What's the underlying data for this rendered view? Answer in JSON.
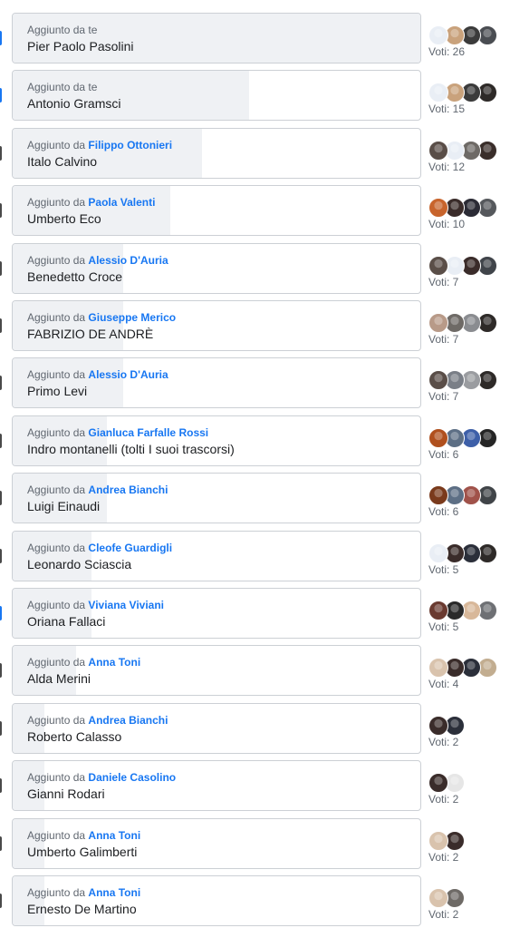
{
  "poll": {
    "options": [
      {
        "added_prefix": "Aggiunto da",
        "added_by": "te",
        "is_self": true,
        "name": "Pier Paolo Pasolini",
        "votes_label": "Voti: 26",
        "votes": 26,
        "checked": true,
        "voter_colors": [
          "#e9eef5",
          "#c9a27c",
          "#3b3b3b",
          "#4a4d52"
        ]
      },
      {
        "added_prefix": "Aggiunto da",
        "added_by": "te",
        "is_self": true,
        "name": "Antonio Gramsci",
        "votes_label": "Voti: 15",
        "votes": 15,
        "checked": true,
        "voter_colors": [
          "#e9eef5",
          "#c9a27c",
          "#3b3b3b",
          "#2e2a28"
        ]
      },
      {
        "added_prefix": "Aggiunto da",
        "added_by": "Filippo Ottonieri",
        "is_self": false,
        "name": "Italo Calvino",
        "votes_label": "Voti: 12",
        "votes": 12,
        "checked": false,
        "voter_colors": [
          "#5a4e48",
          "#e9eef5",
          "#6e6a66",
          "#3a2e2a"
        ]
      },
      {
        "added_prefix": "Aggiunto da",
        "added_by": "Paola Valenti",
        "is_self": false,
        "name": "Umberto Eco",
        "votes_label": "Voti: 10",
        "votes": 10,
        "checked": false,
        "voter_colors": [
          "#c8642c",
          "#3a2c2a",
          "#2b2b35",
          "#55585c"
        ]
      },
      {
        "added_prefix": "Aggiunto da",
        "added_by": "Alessio D'Auria",
        "is_self": false,
        "name": "Benedetto Croce",
        "votes_label": "Voti: 7",
        "votes": 7,
        "checked": false,
        "voter_colors": [
          "#5a4e48",
          "#e9eef5",
          "#3a2c2a",
          "#40444a"
        ]
      },
      {
        "added_prefix": "Aggiunto da",
        "added_by": "Giuseppe Merico",
        "is_self": false,
        "name": "FABRIZIO DE ANDRÈ",
        "votes_label": "Voti: 7",
        "votes": 7,
        "checked": false,
        "voter_colors": [
          "#b89a88",
          "#6e6a66",
          "#8a8c90",
          "#2e2a28"
        ]
      },
      {
        "added_prefix": "Aggiunto da",
        "added_by": "Alessio D'Auria",
        "is_self": false,
        "name": "Primo Levi",
        "votes_label": "Voti: 7",
        "votes": 7,
        "checked": false,
        "voter_colors": [
          "#5a4e48",
          "#7a7f87",
          "#9a9ca0",
          "#2e2a28"
        ]
      },
      {
        "added_prefix": "Aggiunto da",
        "added_by": "Gianluca Farfalle Rossi",
        "is_self": false,
        "name": "Indro montanelli (tolti I suoi trascorsi)",
        "votes_label": "Voti: 6",
        "votes": 6,
        "checked": false,
        "voter_colors": [
          "#b0501e",
          "#5d6f85",
          "#3d5fa8",
          "#252525"
        ]
      },
      {
        "added_prefix": "Aggiunto da",
        "added_by": "Andrea Bianchi",
        "is_self": false,
        "name": "Luigi Einaudi",
        "votes_label": "Voti: 6",
        "votes": 6,
        "checked": false,
        "voter_colors": [
          "#7a3a1c",
          "#5d6f85",
          "#a0524a",
          "#404448"
        ]
      },
      {
        "added_prefix": "Aggiunto da",
        "added_by": "Cleofe Guardigli",
        "is_self": false,
        "name": "Leonardo Sciascia",
        "votes_label": "Voti: 5",
        "votes": 5,
        "checked": false,
        "voter_colors": [
          "#e9eef5",
          "#3a2c2a",
          "#2b2f3a",
          "#2e2a28"
        ]
      },
      {
        "added_prefix": "Aggiunto da",
        "added_by": "Viviana Viviani",
        "is_self": false,
        "name": "Oriana Fallaci",
        "votes_label": "Voti: 5",
        "votes": 5,
        "checked": true,
        "voter_colors": [
          "#6a3a30",
          "#2a2a2a",
          "#d8b89a",
          "#6e7074"
        ]
      },
      {
        "added_prefix": "Aggiunto da",
        "added_by": "Anna Toni",
        "is_self": false,
        "name": "Alda Merini",
        "votes_label": "Voti: 4",
        "votes": 4,
        "checked": false,
        "voter_colors": [
          "#d9c3ad",
          "#3a2c2a",
          "#2b2f3a",
          "#c2ad90"
        ]
      },
      {
        "added_prefix": "Aggiunto da",
        "added_by": "Andrea Bianchi",
        "is_self": false,
        "name": "Roberto Calasso",
        "votes_label": "Voti: 2",
        "votes": 2,
        "checked": false,
        "voter_colors": [
          "#3a2c2a",
          "#2b2f3a"
        ]
      },
      {
        "added_prefix": "Aggiunto da",
        "added_by": "Daniele Casolino",
        "is_self": false,
        "name": "Gianni Rodari",
        "votes_label": "Voti: 2",
        "votes": 2,
        "checked": false,
        "voter_colors": [
          "#3a2c2a",
          "#e6e6e6"
        ]
      },
      {
        "added_prefix": "Aggiunto da",
        "added_by": "Anna Toni",
        "is_self": false,
        "name": "Umberto Galimberti",
        "votes_label": "Voti: 2",
        "votes": 2,
        "checked": false,
        "voter_colors": [
          "#d9c3ad",
          "#3a2c2a"
        ]
      },
      {
        "added_prefix": "Aggiunto da",
        "added_by": "Anna Toni",
        "is_self": false,
        "name": "Ernesto De Martino",
        "votes_label": "Voti: 2",
        "votes": 2,
        "checked": false,
        "voter_colors": [
          "#d9c3ad",
          "#6e6a66"
        ]
      }
    ]
  }
}
